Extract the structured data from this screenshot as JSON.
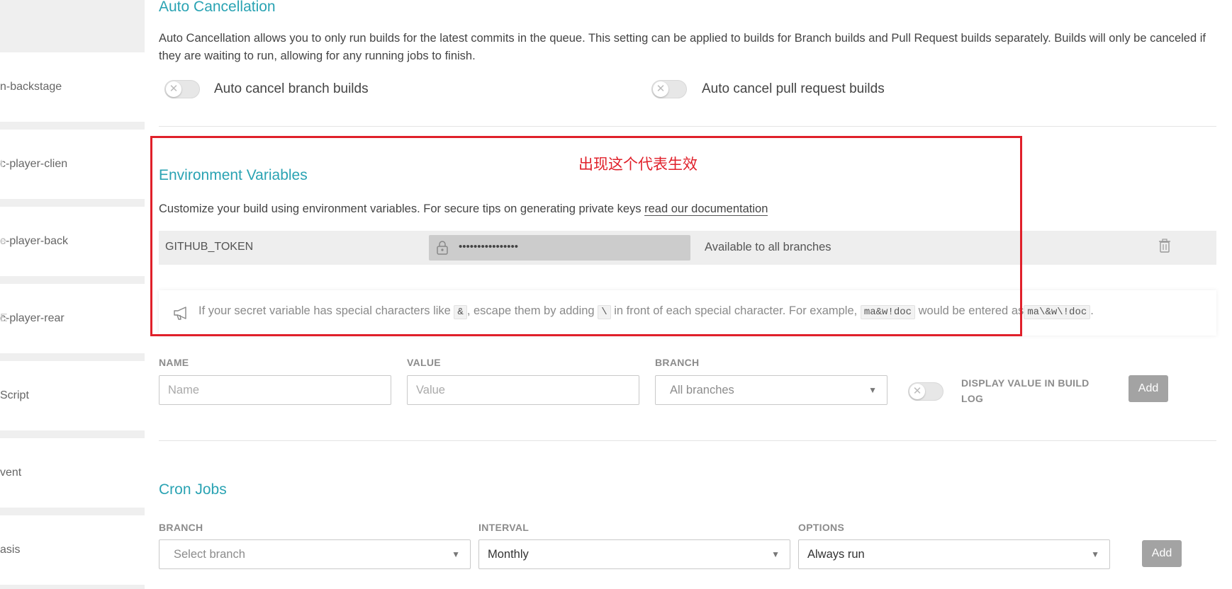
{
  "sidebar": {
    "items": [
      {
        "label": "n-backstage",
        "faded": ""
      },
      {
        "label": "c-player-clien",
        "faded": "t"
      },
      {
        "label": "c-player-back",
        "faded": "e"
      },
      {
        "label": "c-player-rear",
        "faded": "E"
      },
      {
        "label": "Script",
        "faded": ""
      },
      {
        "label": "vent",
        "faded": ""
      },
      {
        "label": "asis",
        "faded": ""
      }
    ]
  },
  "auto_cancellation": {
    "title": "Auto Cancellation",
    "description": "Auto Cancellation allows you to only run builds for the latest commits in the queue. This setting can be applied to builds for Branch builds and Pull Request builds separately. Builds will only be canceled if they are waiting to run, allowing for any running jobs to finish.",
    "branch_toggle_label": "Auto cancel branch builds",
    "pr_toggle_label": "Auto cancel pull request builds",
    "branch_toggle_on": false,
    "pr_toggle_on": false
  },
  "env_vars": {
    "title": "Environment Variables",
    "description": "Customize your build using environment variables. For secure tips on generating private keys",
    "doc_link": "read our documentation",
    "rows": [
      {
        "name": "GITHUB_TOKEN",
        "value_masked": "••••••••••••••••",
        "branch": "Available to all branches"
      }
    ],
    "notice": {
      "t1": "If your secret variable has special characters like",
      "c1": "&",
      "t2": ", escape them by adding",
      "c2": "\\",
      "t3": "in front of each special character. For example,",
      "c3": "ma&w!doc",
      "t4": "would be entered as",
      "c4": "ma\\&w\\!doc",
      "t5": "."
    },
    "form": {
      "name_label": "NAME",
      "name_placeholder": "Name",
      "value_label": "VALUE",
      "value_placeholder": "Value",
      "branch_label": "BRANCH",
      "branch_value": "All branches",
      "display_label_line1": "DISPLAY VALUE IN BUILD",
      "display_label_line2": "LOG",
      "display_toggle_on": false,
      "add_label": "Add"
    }
  },
  "annotation": {
    "text": "出现这个代表生效",
    "color": "#e0202a"
  },
  "cron": {
    "title": "Cron Jobs",
    "branch_label": "BRANCH",
    "branch_placeholder": "Select branch",
    "interval_label": "INTERVAL",
    "interval_value": "Monthly",
    "options_label": "OPTIONS",
    "options_value": "Always run",
    "add_label": "Add"
  },
  "colors": {
    "accent": "#2aa3b3",
    "button": "#a3a3a3"
  }
}
